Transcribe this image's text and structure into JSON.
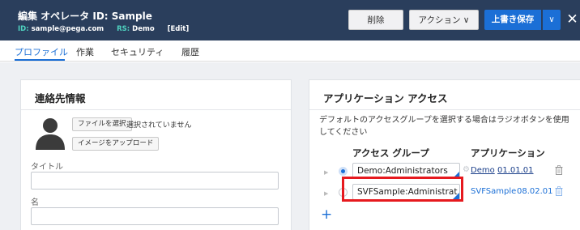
{
  "header": {
    "title": "編集 オペレータ ID: Sample",
    "id_label": "ID:",
    "id_value": "sample@pega.com",
    "rs_label": "RS:",
    "rs_value": "Demo",
    "edit_link": "[Edit]",
    "delete_label": "削除",
    "action_label": "アクション ∨",
    "save_label": "上書き保存",
    "save_caret": "∨",
    "close_glyph": "✕"
  },
  "tabs": [
    {
      "label": "プロファイル"
    },
    {
      "label": "作業"
    },
    {
      "label": "セキュリティ"
    },
    {
      "label": "履歴"
    }
  ],
  "contact": {
    "title": "連絡先情報",
    "file_button": "ファイルを選択",
    "no_file": "選択されていません",
    "upload_button": "イメージをアップロード",
    "title_label": "タイトル",
    "name_label": "名"
  },
  "access": {
    "title": "アプリケーション アクセス",
    "description": "デフォルトのアクセスグループを選択する場合はラジオボタンを使用してください",
    "col_access_group": "アクセス グループ",
    "col_application": "アプリケーション",
    "rows": [
      {
        "access_group": "Demo:Administrators",
        "app": "Demo",
        "version": "01.01.01"
      },
      {
        "access_group": "SVFSample:Administrat",
        "app": "SVFSample",
        "version": "08.02.01"
      }
    ],
    "add_glyph": "+"
  },
  "colors": {
    "header_bg": "#2a3e5c",
    "accent": "#1b6fd6",
    "highlight": "#e6191e"
  }
}
